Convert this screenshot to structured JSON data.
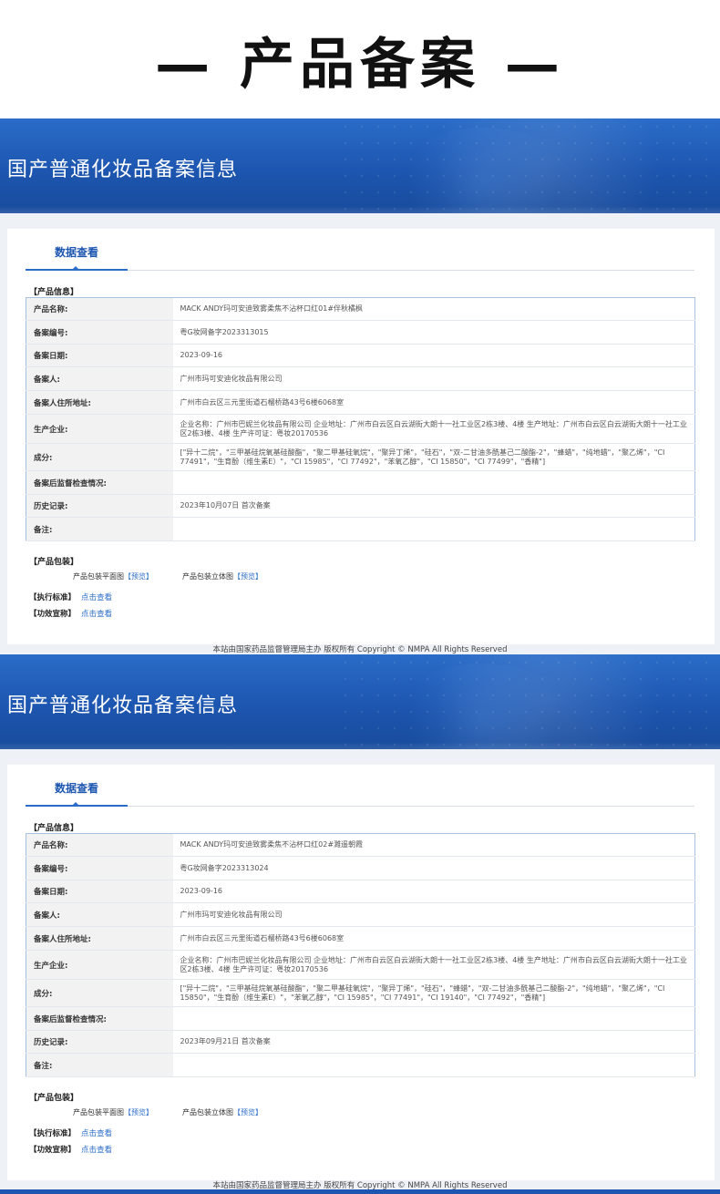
{
  "page_title": "— 产品备案 —",
  "sections": [
    {
      "banner_title": "国产普通化妆品备案信息",
      "tab_label": "数据查看",
      "product_info_label": "【产品信息】",
      "rows": [
        {
          "key": "产品名称:",
          "value": "MACK ANDY玛可安迪致雾柔焦不沾杯口红01#伴秋橘枫"
        },
        {
          "key": "备案编号:",
          "value": "粤G妆网备字2023313015"
        },
        {
          "key": "备案日期:",
          "value": "2023-09-16"
        },
        {
          "key": "备案人:",
          "value": "广州市玛可安迪化妆品有限公司"
        },
        {
          "key": "备案人住所地址:",
          "value": "广州市白云区三元里街道石榴桥路43号6楼6068室"
        },
        {
          "key": "生产企业:",
          "value": "企业名称：广州市巴妮兰化妆品有限公司 企业地址：广州市白云区白云湖街大朗十一社工业区2栋3楼、4楼 生产地址：广州市白云区白云湖街大朗十一社工业区2栋3楼、4楼 生产许可证：粤妆20170536"
        },
        {
          "key": "成分:",
          "value": "[\"异十二烷\"，\"三甲基硅烷氧基硅酸酯\"，\"聚二甲基硅氧烷\"，\"聚异丁烯\"，\"硅石\"，\"双-二甘油多酰基己二酸酯-2\"，\"蜂蜡\"，\"纯地蜡\"，\"聚乙烯\"，\"CI 77491\"，\"生育酚（维生素E）\"，\"CI 15985\"，\"CI 77492\"，\"苯氧乙醇\"，\"CI 15850\"，\"CI 77499\"，\"香精\"]"
        },
        {
          "key": "备案后监督检查情况:",
          "value": ""
        },
        {
          "key": "历史记录:",
          "value": "2023年10月07日 首次备案"
        },
        {
          "key": "备注:",
          "value": ""
        }
      ],
      "package_label": "【产品包装】",
      "package_plan": "产品包装平面图",
      "package_3d": "产品包装立体图",
      "preview_link": "【预览】",
      "standard_label": "【执行标准】",
      "efficacy_label": "【功效宣称】",
      "view_link": "点击查看",
      "footer": "本站由国家药品监督管理局主办 版权所有 Copyright © NMPA All Rights Reserved"
    },
    {
      "banner_title": "国产普通化妆品备案信息",
      "tab_label": "数据查看",
      "product_info_label": "【产品信息】",
      "rows": [
        {
          "key": "产品名称:",
          "value": "MACK ANDY玛可安迪致雾柔焦不沾杯口红02#濉遥朝霞"
        },
        {
          "key": "备案编号:",
          "value": "粤G妆网备字2023313024"
        },
        {
          "key": "备案日期:",
          "value": "2023-09-16"
        },
        {
          "key": "备案人:",
          "value": "广州市玛可安迪化妆品有限公司"
        },
        {
          "key": "备案人住所地址:",
          "value": "广州市白云区三元里街道石榴桥路43号6楼6068室"
        },
        {
          "key": "生产企业:",
          "value": "企业名称：广州市巴妮兰化妆品有限公司 企业地址：广州市白云区白云湖街大朗十一社工业区2栋3楼、4楼 生产地址：广州市白云区白云湖街大朗十一社工业区2栋3楼、4楼 生产许可证：粤妆20170536"
        },
        {
          "key": "成分:",
          "value": "[\"异十二烷\"，\"三甲基硅烷氧基硅酸酯\"，\"聚二甲基硅氧烷\"，\"聚异丁烯\"，\"硅石\"，\"蜂蜡\"，\"双-二甘油多酰基己二酸酯-2\"，\"纯地蜡\"，\"聚乙烯\"，\"CI 15850\"，\"生育酚（维生素E）\"，\"苯氧乙醇\"，\"CI 15985\"，\"CI 77491\"，\"CI 19140\"，\"CI 77492\"，\"香精\"]"
        },
        {
          "key": "备案后监督检查情况:",
          "value": ""
        },
        {
          "key": "历史记录:",
          "value": "2023年09月21日 首次备案"
        },
        {
          "key": "备注:",
          "value": ""
        }
      ],
      "package_label": "【产品包装】",
      "package_plan": "产品包装平面图",
      "package_3d": "产品包装立体图",
      "preview_link": "【预览】",
      "standard_label": "【执行标准】",
      "efficacy_label": "【功效宣称】",
      "view_link": "点击查看",
      "footer": "本站由国家药品监督管理局主办 版权所有 Copyright © NMPA All Rights Reserved"
    }
  ]
}
